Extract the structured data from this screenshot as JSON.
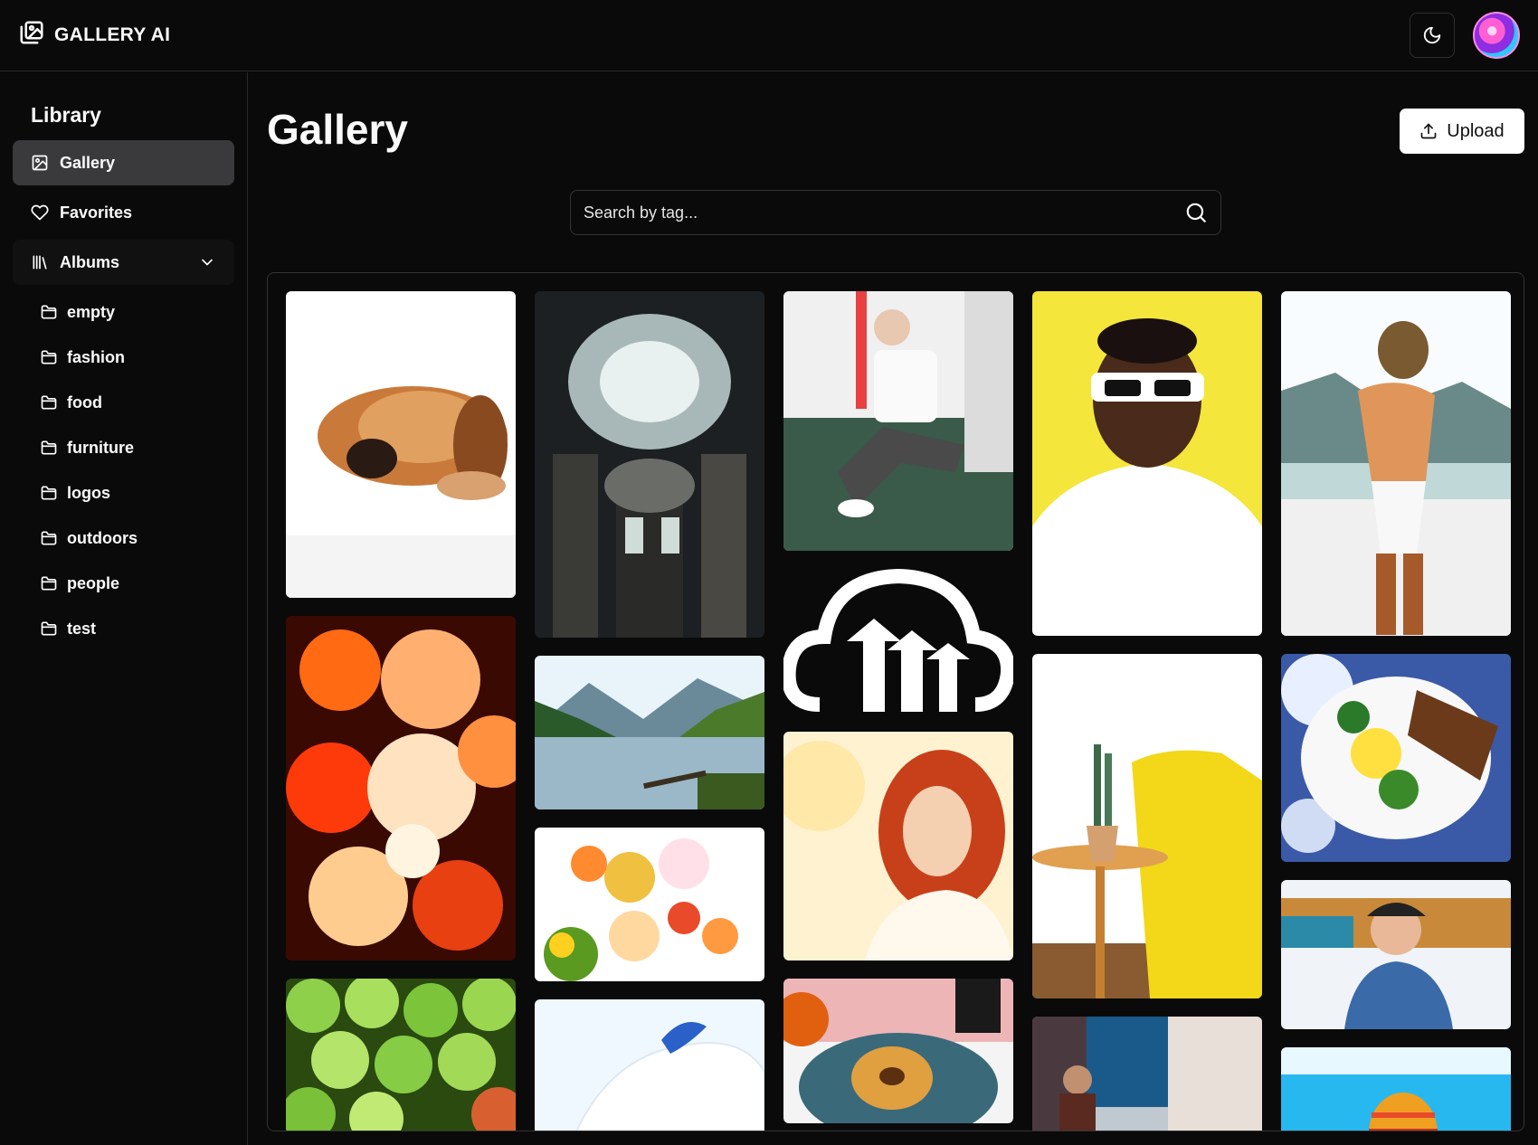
{
  "header": {
    "brand": "GALLERY AI",
    "icons": [
      "gallery-logo-icon",
      "moon-icon",
      "avatar"
    ]
  },
  "sidebar": {
    "heading": "Library",
    "items": [
      {
        "label": "Gallery",
        "icon": "image-icon",
        "active": true
      },
      {
        "label": "Favorites",
        "icon": "heart-icon"
      },
      {
        "label": "Albums",
        "icon": "library-icon",
        "expanded": true
      }
    ],
    "albums": [
      "empty",
      "fashion",
      "food",
      "furniture",
      "logos",
      "outdoors",
      "people",
      "test"
    ]
  },
  "main": {
    "title": "Gallery",
    "upload_label": "Upload",
    "search_placeholder": "Search by tag..."
  },
  "colors": {
    "background": "#0a0a0a",
    "active_nav": "#3a3a3d",
    "border": "#2a2a2a",
    "upload_bg": "#ffffff"
  },
  "gallery": {
    "images": [
      "sleeping-dog",
      "red-flowers",
      "green-apples",
      "cathedral-dome",
      "mountain-lake",
      "breakfast-bowls",
      "white-sneaker",
      "woman-sitting-turf",
      "cloud-upload-logo",
      "red-haired-woman",
      "donut-table",
      "man-white-sunglasses",
      "yellow-armchair",
      "street-crowd",
      "woman-orange-sweater",
      "food-plate-blue",
      "smiling-man-cap",
      "hot-air-balloon"
    ]
  }
}
